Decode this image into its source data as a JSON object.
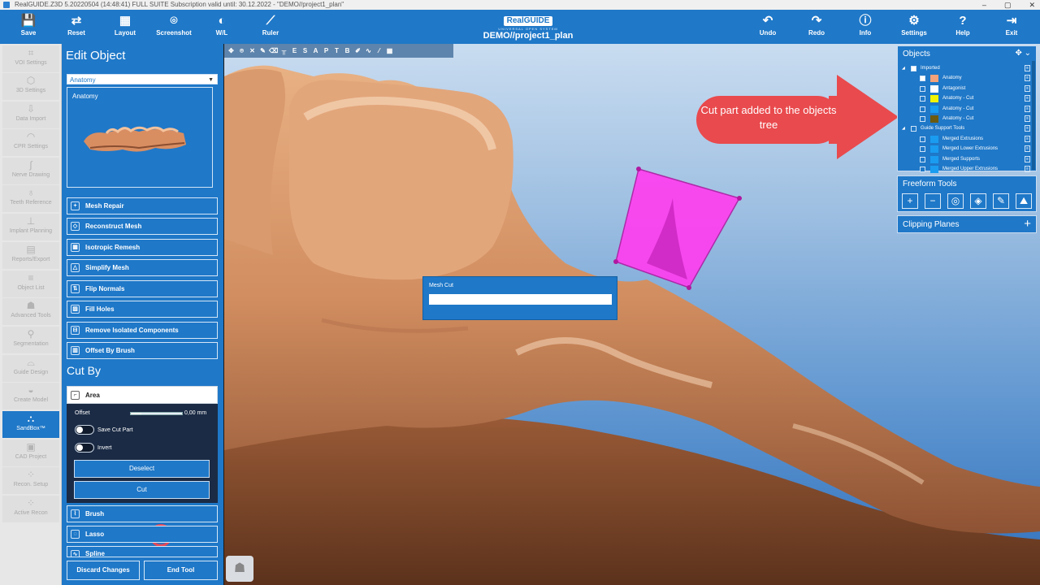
{
  "window": {
    "title": "RealGUIDE.Z3D   5.20220504 (14:48:41)  FULL SUITE Subscription valid until: 30.12.2022  -  \"DEMO//project1_plan\"",
    "controls": [
      "–",
      "▢",
      "✕"
    ]
  },
  "toolbar": {
    "left": [
      {
        "label": "Save",
        "icon": "save-icon"
      },
      {
        "label": "Reset",
        "icon": "reset-icon"
      },
      {
        "label": "Layout",
        "icon": "layout-icon"
      },
      {
        "label": "Screenshot",
        "icon": "camera-icon"
      },
      {
        "label": "W/L",
        "icon": "contrast-icon"
      },
      {
        "label": "Ruler",
        "icon": "ruler-icon"
      }
    ],
    "right": [
      {
        "label": "Undo",
        "icon": "undo-icon"
      },
      {
        "label": "Redo",
        "icon": "redo-icon"
      },
      {
        "label": "Info",
        "icon": "info-icon"
      },
      {
        "label": "Settings",
        "icon": "gear-icon"
      },
      {
        "label": "Help",
        "icon": "help-icon"
      },
      {
        "label": "Exit",
        "icon": "exit-icon"
      }
    ],
    "logo_main": "RealGUIDE",
    "logo_sub": "UNIVERSAL OPEN SYSTEM",
    "project_title": "DEMO//project1_plan"
  },
  "nav": {
    "items": [
      {
        "label": "VOI Settings",
        "icon": "voi-icon"
      },
      {
        "label": "3D Settings",
        "icon": "cube-icon"
      },
      {
        "label": "Data Import",
        "icon": "import-icon"
      },
      {
        "label": "CPR Settings",
        "icon": "cpr-icon"
      },
      {
        "label": "Nerve Drawing",
        "icon": "nerve-icon"
      },
      {
        "label": "Teeth Reference",
        "icon": "tooth-icon"
      },
      {
        "label": "Implant Planning",
        "icon": "implant-icon"
      },
      {
        "label": "Reports/Export",
        "icon": "report-icon"
      },
      {
        "label": "Object List",
        "icon": "list-icon"
      },
      {
        "label": "Advanced Tools",
        "icon": "tools-icon"
      },
      {
        "label": "Segmentation",
        "icon": "segmentation-icon"
      },
      {
        "label": "Guide Design",
        "icon": "guide-icon"
      },
      {
        "label": "Create Model",
        "icon": "model-icon"
      },
      {
        "label": "SandBox™",
        "icon": "sandbox-icon"
      },
      {
        "label": "CAD Project",
        "icon": "cad-icon"
      },
      {
        "label": "Recon. Setup",
        "icon": "recon-setup-icon"
      },
      {
        "label": "Active Recon",
        "icon": "active-recon-icon"
      }
    ],
    "active_index": 13
  },
  "edit_panel": {
    "title": "Edit Object",
    "dropdown_value": "Anatomy",
    "preview_label": "Anatomy",
    "buttons": [
      {
        "label": "Mesh Repair",
        "icon": "plus-icon"
      },
      {
        "label": "Reconstruct Mesh",
        "icon": "reconstruct-icon"
      },
      {
        "label": "Isotropic Remesh",
        "icon": "remesh-icon"
      },
      {
        "label": "Simplify Mesh",
        "icon": "simplify-icon"
      },
      {
        "label": "Flip Normals",
        "icon": "flip-icon"
      },
      {
        "label": "Fill Holes",
        "icon": "fill-holes-icon"
      },
      {
        "label": "Remove Isolated Components",
        "icon": "remove-components-icon"
      },
      {
        "label": "Offset By Brush",
        "icon": "brush-offset-icon"
      }
    ],
    "cut_by_title": "Cut By",
    "area_label": "Area",
    "offset_label": "Offset",
    "offset_value": "0,00 mm",
    "offset_fraction": 0.2,
    "save_cut_part_label": "Save Cut Part",
    "invert_label": "Invert",
    "deselect_label": "Deselect",
    "cut_label": "Cut",
    "tools_below": [
      {
        "label": "Brush",
        "icon": "brush-icon"
      },
      {
        "label": "Lasso",
        "icon": "lasso-icon"
      },
      {
        "label": "Spline",
        "icon": "spline-icon"
      }
    ],
    "discard_label": "Discard Changes",
    "end_tool_label": "End Tool"
  },
  "viewport": {
    "toolbar_icons": [
      "move-icon",
      "camera-icon",
      "close-icon",
      "pen-icon",
      "erase-icon",
      "wall-icon",
      "E",
      "S",
      "A",
      "P",
      "T",
      "B",
      "pencil-icon",
      "curve-icon",
      "line-icon",
      "grid-icon"
    ],
    "toolbar_letters": [
      "E",
      "S",
      "A",
      "P",
      "T",
      "B"
    ],
    "mesh_cut_label": "Mesh Cut",
    "cut_plane_color": "#ff3ef0",
    "mesh_color": "#d9956a"
  },
  "objects_panel": {
    "title": "Objects",
    "rows": [
      {
        "label": "Imported",
        "level": 0,
        "swatch": "",
        "checked": true
      },
      {
        "label": "Anatomy",
        "level": 1,
        "swatch": "#f4a27a",
        "checked": true
      },
      {
        "label": "Antagonist",
        "level": 1,
        "swatch": "#ffffff",
        "checked": false
      },
      {
        "label": "Anatomy - Cut",
        "level": 1,
        "swatch": "#f4f400",
        "checked": false
      },
      {
        "label": "Anatomy - Cut",
        "level": 1,
        "swatch": "#1a9cf0",
        "checked": false
      },
      {
        "label": "Anatomy - Cut",
        "level": 1,
        "swatch": "#6b5a10",
        "checked": false
      },
      {
        "label": "Guide Support Tools",
        "level": 0,
        "swatch": "",
        "checked": false
      },
      {
        "label": "Merged Extrusions",
        "level": 1,
        "swatch": "#1a9cf0",
        "checked": false
      },
      {
        "label": "Merged Lower Extrusions",
        "level": 1,
        "swatch": "#1a9cf0",
        "checked": false
      },
      {
        "label": "Merged Supports",
        "level": 1,
        "swatch": "#1a9cf0",
        "checked": false
      },
      {
        "label": "Merged Upper Extrusions",
        "level": 1,
        "swatch": "#1a9cf0",
        "checked": false
      }
    ]
  },
  "freeform_panel": {
    "title": "Freeform Tools",
    "tools": [
      "add-icon",
      "subtract-icon",
      "circle-icon",
      "fill-icon",
      "draw-icon",
      "smooth-icon"
    ]
  },
  "clipping_panel": {
    "title": "Clipping Planes"
  },
  "callout": {
    "text": "Cut part added to the objects tree",
    "color": "#e94a4d"
  }
}
